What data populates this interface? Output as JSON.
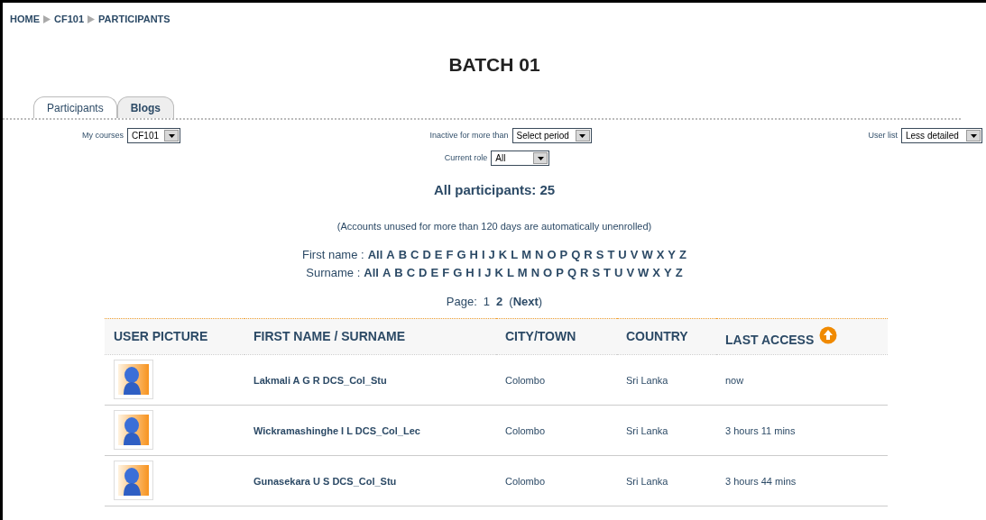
{
  "breadcrumb": [
    "HOME",
    "CF101",
    "PARTICIPANTS"
  ],
  "title": "BATCH 01",
  "tabs": [
    {
      "label": "Participants",
      "selected": true
    },
    {
      "label": "Blogs",
      "selected": false
    }
  ],
  "my_courses": {
    "label": "My courses",
    "value": "CF101"
  },
  "inactive": {
    "label": "Inactive for more than",
    "value": "Select period"
  },
  "user_list": {
    "label": "User list",
    "value": "Less detailed"
  },
  "current_role": {
    "label": "Current role",
    "value": "All"
  },
  "heading": "All participants: 25",
  "note": "(Accounts unused for more than 120 days are automatically unenrolled)",
  "filters": [
    {
      "label": "First name :",
      "letters": [
        "All",
        "A",
        "B",
        "C",
        "D",
        "E",
        "F",
        "G",
        "H",
        "I",
        "J",
        "K",
        "L",
        "M",
        "N",
        "O",
        "P",
        "Q",
        "R",
        "S",
        "T",
        "U",
        "V",
        "W",
        "X",
        "Y",
        "Z"
      ]
    },
    {
      "label": "Surname :",
      "letters": [
        "All",
        "A",
        "B",
        "C",
        "D",
        "E",
        "F",
        "G",
        "H",
        "I",
        "J",
        "K",
        "L",
        "M",
        "N",
        "O",
        "P",
        "Q",
        "R",
        "S",
        "T",
        "U",
        "V",
        "W",
        "X",
        "Y",
        "Z"
      ]
    }
  ],
  "paging": {
    "label": "Page:",
    "pages": [
      {
        "label": "1",
        "selected": false
      },
      {
        "label": "2",
        "selected": true
      }
    ],
    "next": "(**Next**)"
  },
  "table": {
    "columns": [
      "USER PICTURE",
      "FIRST NAME / SURNAME",
      "CITY/TOWN",
      "COUNTRY",
      "LAST ACCESS"
    ],
    "rows": [
      {
        "name": "Lakmali A G R DCS_Col_Stu",
        "city": "Colombo",
        "country": "Sri Lanka",
        "last_access": "now"
      },
      {
        "name": "Wickramashinghe I L DCS_Col_Lec",
        "city": "Colombo",
        "country": "Sri Lanka",
        "last_access": "3 hours 11 mins"
      },
      {
        "name": "Gunasekara U S DCS_Col_Stu",
        "city": "Colombo",
        "country": "Sri Lanka",
        "last_access": "3 hours 44 mins"
      }
    ]
  }
}
